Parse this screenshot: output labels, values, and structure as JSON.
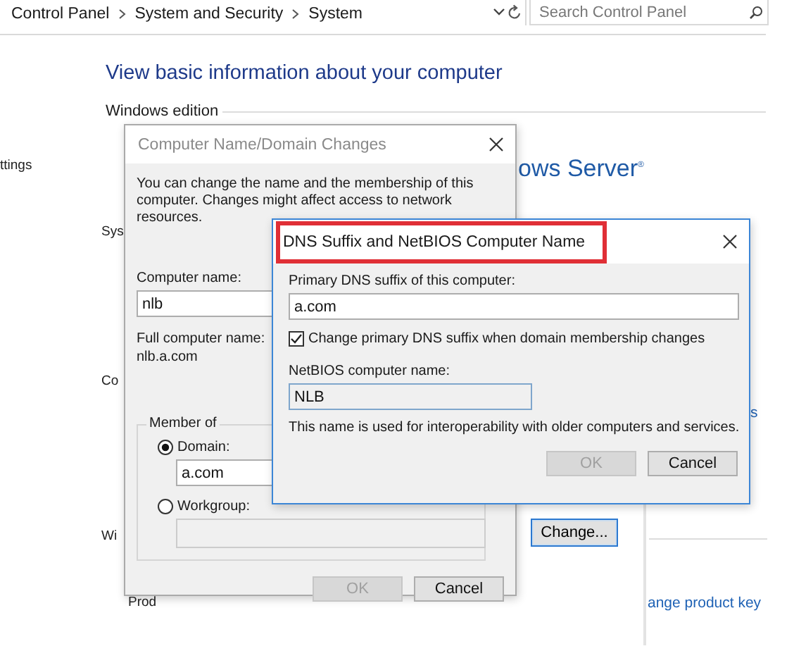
{
  "address_bar": {
    "breadcrumbs": [
      "Control Panel",
      "System and Security",
      "System"
    ],
    "search": {
      "placeholder": "Search Control Panel"
    }
  },
  "page": {
    "heading": "View basic information about your computer",
    "section": "Windows edition",
    "fragments": [
      {
        "kind": "label",
        "text": "ttings"
      },
      {
        "kind": "label",
        "text": "Sys"
      },
      {
        "kind": "label",
        "text": "Co"
      },
      {
        "kind": "label",
        "text": "Wi"
      },
      {
        "kind": "label",
        "text": "Prod"
      },
      {
        "kind": "brand",
        "text": "ows Server$^{®}$"
      },
      {
        "kind": "link",
        "text": "s"
      },
      {
        "kind": "link",
        "text": "ange product key"
      }
    ],
    "change_button": "Change..."
  },
  "computer_name_dialog": {
    "title": "Computer Name/Domain Changes",
    "active": false,
    "intro": "You can change the name and the membership of this computer. Changes might affect access to network resources.",
    "computer_name_label": "Computer name:",
    "computer_name": "nlb",
    "full_name_label": "Full computer name:",
    "full_name": "nlb.a.com",
    "member_of": {
      "label": "Member of",
      "options": [
        {
          "label": "Domain:",
          "selected": true,
          "value": "a.com"
        },
        {
          "label": "Workgroup:",
          "selected": false
        }
      ]
    },
    "buttons": [
      {
        "label": "OK",
        "disabled": true
      },
      {
        "label": "Cancel",
        "disabled": false
      }
    ]
  },
  "dns_dialog": {
    "title": "DNS Suffix and NetBIOS Computer Name",
    "active": true,
    "title_highlighted": true,
    "primary_label": "Primary DNS suffix of this computer:",
    "primary_value": "a.com",
    "checkbox": {
      "label": "Change primary DNS suffix when domain membership changes",
      "checked": true
    },
    "netbios_label": "NetBIOS computer name:",
    "netbios_value": "NLB",
    "note": "This name is used for interoperability with older computers and services.",
    "buttons": [
      {
        "label": "OK",
        "disabled": true
      },
      {
        "label": "Cancel",
        "disabled": false
      }
    ]
  }
}
